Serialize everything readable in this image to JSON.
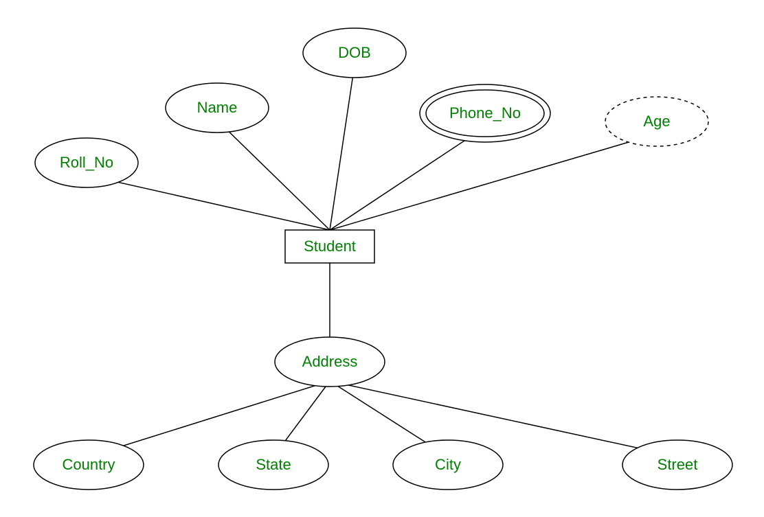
{
  "diagram": {
    "entity": "Student",
    "attributes": {
      "roll_no": "Roll_No",
      "name": "Name",
      "dob": "DOB",
      "phone_no": "Phone_No",
      "age": "Age",
      "address": "Address"
    },
    "address_components": {
      "country": "Country",
      "state": "State",
      "city": "City",
      "street": "Street"
    },
    "colors": {
      "text": "#008000",
      "stroke": "#000000",
      "background": "#ffffff"
    },
    "notation": {
      "rectangle": "entity",
      "ellipse": "simple attribute",
      "double_ellipse": "multivalued attribute",
      "dashed_ellipse": "derived attribute"
    }
  }
}
